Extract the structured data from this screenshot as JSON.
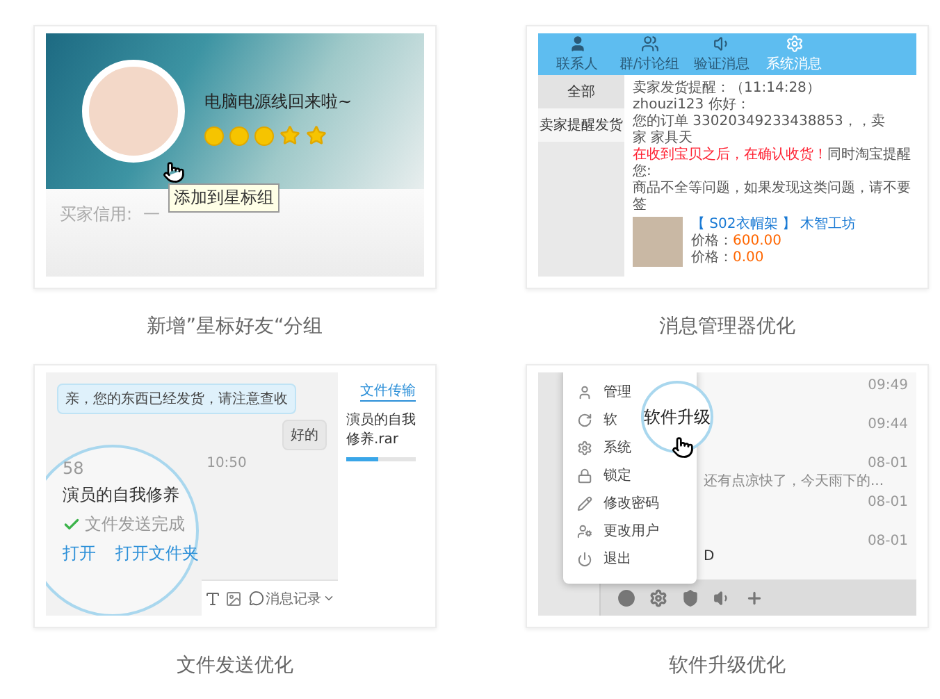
{
  "features": [
    {
      "kind": "star_group",
      "caption": "新增”星标好友“分组",
      "screen": {
        "status": "电脑电源线回来啦~",
        "badges": [
          {
            "kind": "coin"
          },
          {
            "kind": "coin"
          },
          {
            "kind": "coin"
          },
          {
            "kind": "star"
          },
          {
            "kind": "star"
          }
        ],
        "tooltip": "添加到星标组",
        "credit_label": "买家信用:",
        "credit_value": "—"
      }
    },
    {
      "kind": "message_manager",
      "caption": "消息管理器优化",
      "screen": {
        "tabs": [
          {
            "kind": "user",
            "label": "联系人",
            "selected": false
          },
          {
            "kind": "group",
            "label": "群/讨论组",
            "selected": false
          },
          {
            "kind": "speaker",
            "label": "验证消息",
            "selected": false
          },
          {
            "kind": "gear",
            "label": "系统消息",
            "selected": true
          }
        ],
        "categories": [
          {
            "label": "全部",
            "selected": false
          },
          {
            "label": "卖家提醒发货",
            "selected": true
          }
        ],
        "message": {
          "title": "卖家发货提醒：",
          "time": "（11:14:28）",
          "greeting": "zhouzi123 你好：",
          "order": "您的订单 33020349233438853，，卖家 家具天",
          "warning": "在收到宝贝之后，在确认收货！",
          "notice": "同时淘宝提醒您:",
          "note": "商品不全等问题，如果发现这类问题，请不要签",
          "product": "【 S02衣帽架 】 木智工坊",
          "prices": [
            {
              "label": "价格：",
              "value": "600.00"
            },
            {
              "label": "价格：",
              "value": "0.00"
            }
          ]
        }
      }
    },
    {
      "kind": "file_transfer",
      "caption": "文件发送优化",
      "screen": {
        "bubbles": [
          {
            "kind": "received",
            "text": "亲，您的东西已经发货，请注意查收"
          },
          {
            "kind": "sent",
            "text": "好的"
          }
        ],
        "time": "10:50",
        "file": {
          "number": "58",
          "name": "演员的自我修养",
          "status": "文件发送完成",
          "actions": [
            "打开",
            "打开文件夹"
          ]
        },
        "history": "消息记录",
        "side_tabs": [
          {
            "label": "文件传输",
            "selected": true
          }
        ],
        "transfer": {
          "name": "演员的自我修养.rar",
          "level": 0.45
        }
      }
    },
    {
      "kind": "software_update",
      "caption": "软件升级优化",
      "screen": {
        "menu": [
          {
            "kind": "user",
            "label": "管理"
          },
          {
            "kind": "update",
            "label": "软"
          },
          {
            "kind": "gear",
            "label": "系统"
          },
          {
            "kind": "lock",
            "label": "锁定"
          },
          {
            "kind": "pencil",
            "label": "修改密码"
          },
          {
            "kind": "switch",
            "label": "更改用户"
          },
          {
            "kind": "power",
            "label": "退出"
          }
        ],
        "magnified": "软件升级",
        "conversations": [
          {
            "time": "09:49"
          },
          {
            "time": "09:44"
          },
          {
            "time": "08-01",
            "preview": "还有点凉快了，今天雨下的..."
          },
          {
            "time": "08-01"
          },
          {
            "time": "08-01",
            "name": "D"
          }
        ],
        "toolbar": [
          {
            "kind": "circle"
          },
          {
            "kind": "gear"
          },
          {
            "kind": "shield"
          },
          {
            "kind": "speaker"
          },
          {
            "kind": "plus"
          }
        ]
      }
    }
  ]
}
